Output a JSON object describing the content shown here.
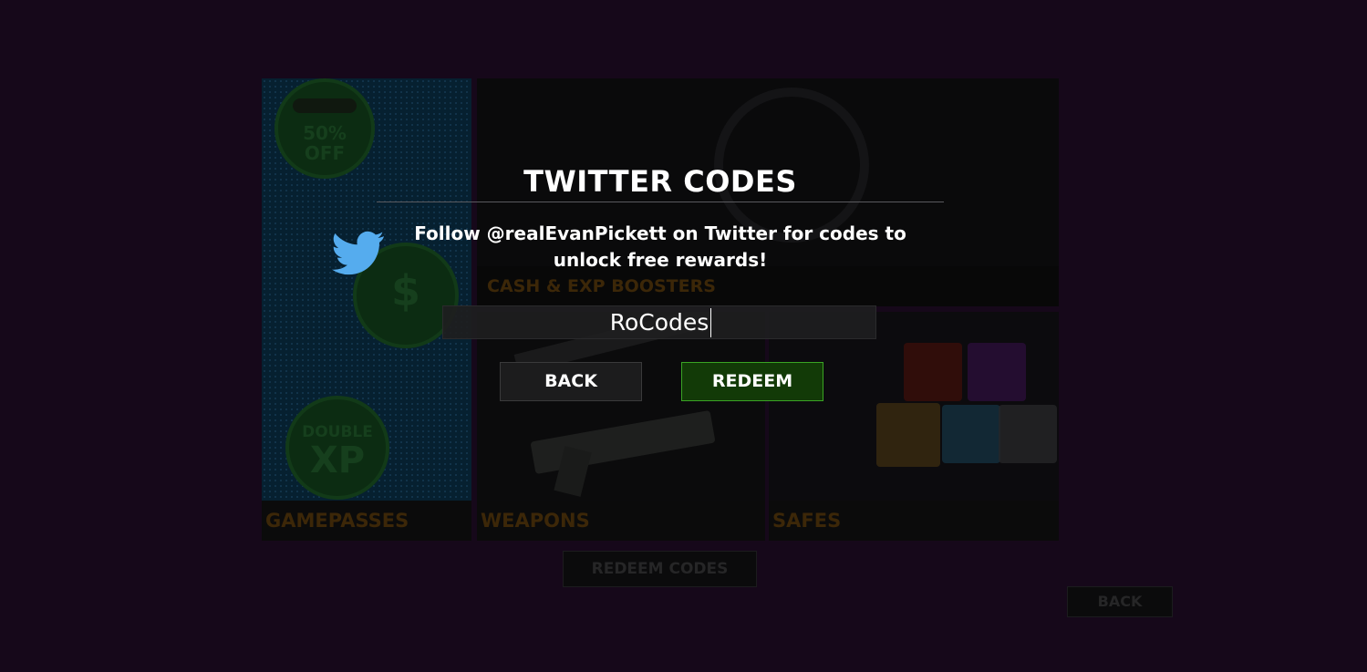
{
  "shop": {
    "sections": {
      "cash_boosters": "CASH & EXP BOOSTERS",
      "gamepasses": "GAMEPASSES",
      "weapons": "WEAPONS",
      "safes": "SAFES"
    },
    "badges": {
      "off_percent": "50%",
      "off_word": "OFF",
      "double_word": "DOUBLE",
      "xp_word": "XP",
      "dollar": "$"
    },
    "redeem_codes_label": "REDEEM CODES",
    "back_label": "BACK"
  },
  "dialog": {
    "title": "TWITTER CODES",
    "message": "Follow @realEvanPickett on Twitter for codes to unlock free rewards!",
    "input_value": "RoCodes",
    "back_label": "BACK",
    "redeem_label": "REDEEM",
    "icon": "twitter-bird-icon"
  },
  "colors": {
    "twitter_blue": "#55acee",
    "redeem_green": "#123a07",
    "redeem_border": "#3aa424"
  }
}
